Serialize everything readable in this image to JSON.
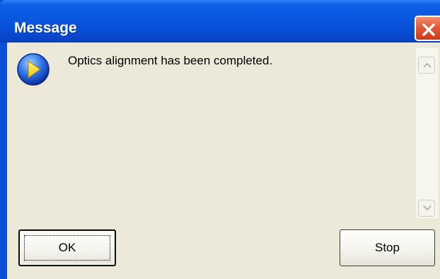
{
  "window": {
    "title": "Message",
    "close_icon": "close-icon",
    "colors": {
      "titlebar": "#0a55df",
      "close": "#e35b38",
      "client": "#ece9d8"
    }
  },
  "message": {
    "icon": "play-arrow-icon",
    "text": "Optics alignment has been completed."
  },
  "scrollbar": {
    "up_icon": "chevron-up-icon",
    "down_icon": "chevron-down-icon"
  },
  "buttons": {
    "ok_label": "OK",
    "stop_label": "Stop"
  }
}
